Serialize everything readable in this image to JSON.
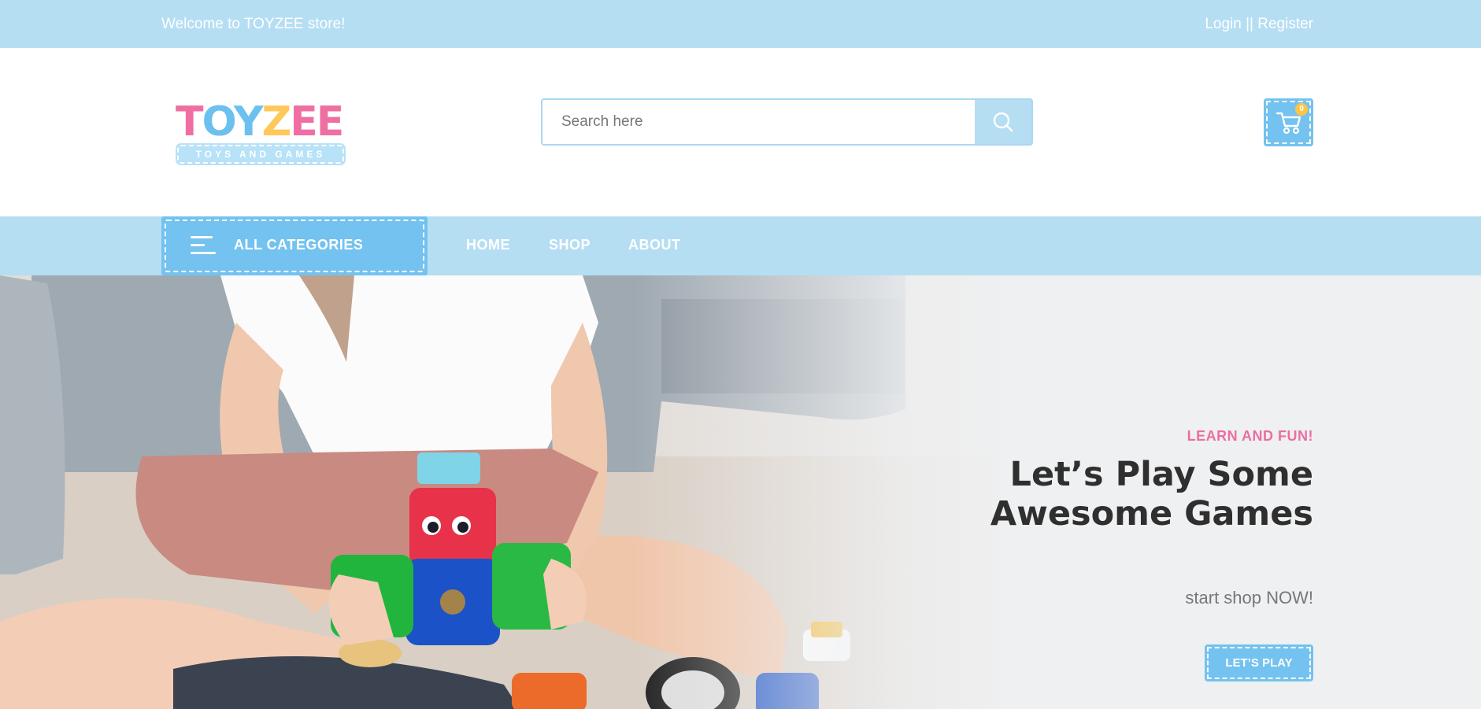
{
  "topbar": {
    "welcome": "Welcome to TOYZEE store!",
    "auth": "Login || Register"
  },
  "header": {
    "logo": {
      "word": "TOYZEE",
      "tagline": "TOYS AND GAMES"
    },
    "search": {
      "placeholder": "Search here",
      "value": ""
    },
    "cart": {
      "count": "0"
    }
  },
  "nav": {
    "all_categories": "ALL CATEGORIES",
    "links": [
      "HOME",
      "SHOP",
      "ABOUT"
    ]
  },
  "hero": {
    "eyebrow": "LEARN AND FUN!",
    "headline": "Let’s Play Some Awesome Games",
    "subtitle": "start shop NOW!",
    "cta": "LET’S PLAY"
  },
  "colors": {
    "topbar_bg": "#b5def3",
    "accent_blue": "#73c2ef",
    "pink": "#ec6ea1",
    "yellow": "#ffc443",
    "hero_bg": "#eff0f1"
  },
  "icons": [
    "search-icon",
    "cart-icon",
    "menu-icon"
  ]
}
